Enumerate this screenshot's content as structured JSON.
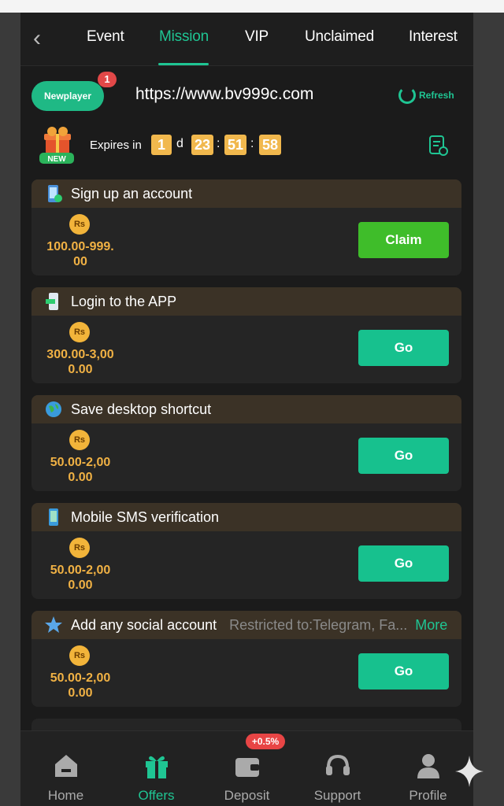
{
  "tabs": [
    {
      "label": "Event"
    },
    {
      "label": "Mission"
    },
    {
      "label": "VIP"
    },
    {
      "label": "Unclaimed"
    },
    {
      "label": "Interest"
    }
  ],
  "active_tab": "Mission",
  "header": {
    "badge_label": "Newplayer",
    "badge_count": "1",
    "url": "https://www.bv999c.com",
    "refresh_label": "Refresh",
    "new_label": "NEW",
    "expires_label": "Expires in",
    "timer": {
      "days": "1",
      "d_label": "d",
      "hours": "23",
      "minutes": "51",
      "seconds": "58",
      "sep": ":"
    }
  },
  "coin_label": "Rs",
  "tasks": [
    {
      "title": "Sign up an account",
      "amount_line1": "100.00-999.",
      "amount_line2": "00",
      "button": "Claim"
    },
    {
      "title": "Login to the APP",
      "amount_line1": "300.00-3,00",
      "amount_line2": "0.00",
      "button": "Go"
    },
    {
      "title": "Save desktop shortcut",
      "amount_line1": "50.00-2,00",
      "amount_line2": "0.00",
      "button": "Go"
    },
    {
      "title": "Mobile SMS verification",
      "amount_line1": "50.00-2,00",
      "amount_line2": "0.00",
      "button": "Go"
    },
    {
      "title": "Add any social account",
      "restriction": "Restricted to:Telegram, Fa...",
      "more": "More",
      "amount_line1": "50.00-2,00",
      "amount_line2": "0.00",
      "button": "Go"
    }
  ],
  "bottom_nav": [
    {
      "label": "Home",
      "icon": "home-icon"
    },
    {
      "label": "Offers",
      "icon": "gift-icon"
    },
    {
      "label": "Deposit",
      "icon": "wallet-icon",
      "badge": "+0.5%"
    },
    {
      "label": "Support",
      "icon": "headset-icon"
    },
    {
      "label": "Profile",
      "icon": "person-icon"
    }
  ],
  "colors": {
    "accent": "#1fc593",
    "claim": "#3fbd2a",
    "gold": "#f0b144",
    "badge_red": "#e24848"
  }
}
